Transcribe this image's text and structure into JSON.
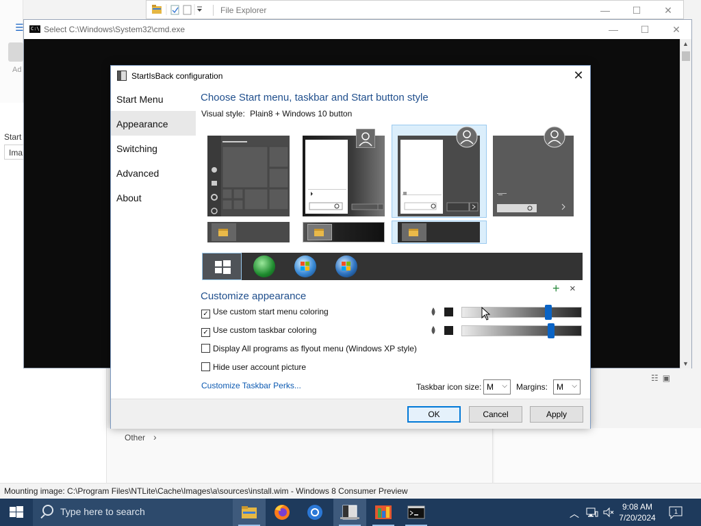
{
  "file_explorer": {
    "title": "File Explorer"
  },
  "cmd": {
    "title": "Select C:\\Windows\\System32\\cmd.exe"
  },
  "background": {
    "toolbar_label": "Ad",
    "start_label": "Start",
    "image_label": "Ima",
    "other_label": "Other",
    "status_text": "Mounting image: C:\\Program Files\\NTLite\\Cache\\Images\\a\\sources\\install.wim - Windows 8 Consumer Preview"
  },
  "dialog": {
    "title": "StartIsBack configuration",
    "nav": [
      {
        "label": "Start Menu"
      },
      {
        "label": "Appearance"
      },
      {
        "label": "Switching"
      },
      {
        "label": "Advanced"
      },
      {
        "label": "About"
      }
    ],
    "heading": "Choose Start menu, taskbar and Start button style",
    "visual_style_label": "Visual style:",
    "visual_style_value": "Plain8 + Windows 10 button",
    "customize_heading": "Customize appearance",
    "options": [
      {
        "label": "Use custom start menu coloring",
        "checked": true
      },
      {
        "label": "Use custom taskbar coloring",
        "checked": true
      },
      {
        "label": "Display All programs as flyout menu (Windows XP style)",
        "checked": false
      },
      {
        "label": "Hide user account picture",
        "checked": false
      }
    ],
    "sliders": [
      {
        "level": 0.73
      },
      {
        "level": 0.75
      }
    ],
    "perks_link": "Customize Taskbar Perks...",
    "icon_size_label": "Taskbar icon size:",
    "icon_size_value": "M",
    "margins_label": "Margins:",
    "margins_value": "M",
    "buttons": {
      "ok": "OK",
      "cancel": "Cancel",
      "apply": "Apply"
    },
    "add_symbol": "+",
    "remove_symbol": "×"
  },
  "taskbar": {
    "search_placeholder": "Type here to search",
    "time": "9:08 AM",
    "date": "7/20/2024"
  },
  "colors": {
    "accent": "#0078d7",
    "heading": "#1f4e8c",
    "link": "#0b59b1",
    "taskbar": "#1e3a5c"
  }
}
